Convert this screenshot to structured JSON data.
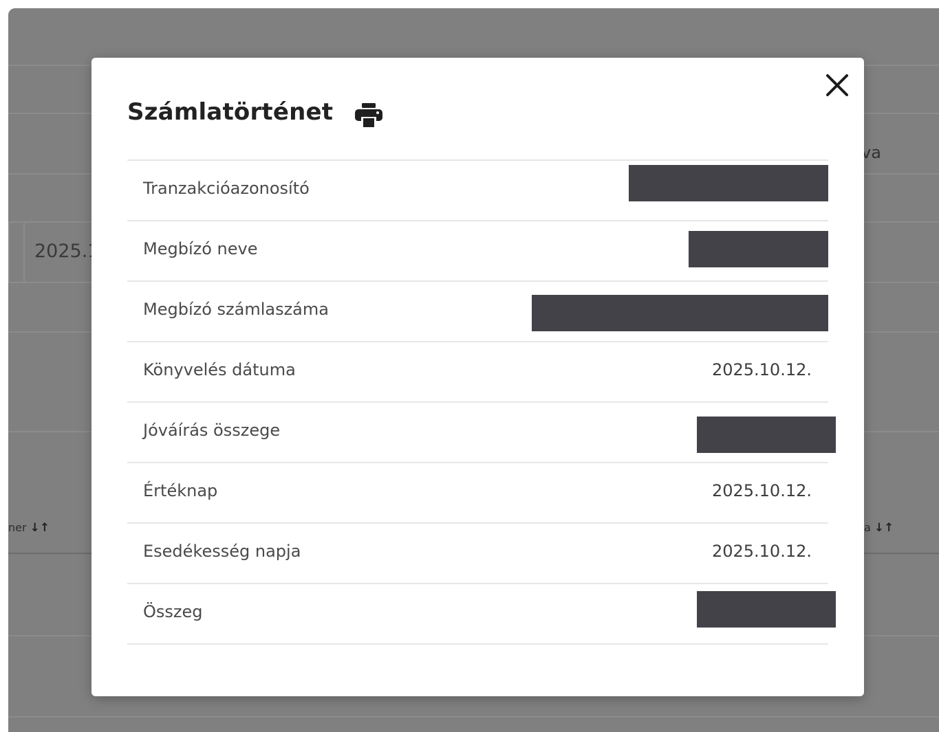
{
  "background": {
    "date_fragment": "2025.1",
    "header_fragment_right": "va",
    "sort_fragment_left": "ner",
    "sort_fragment_right": "a",
    "sort_glyph": "↓↑"
  },
  "modal": {
    "title": "Számlatörténet",
    "print_icon": "print-icon",
    "close_icon": "close-icon",
    "rows": [
      {
        "label": "Tranzakcióazonosító",
        "value": "",
        "redacted": true
      },
      {
        "label": "Megbízó neve",
        "value": "",
        "redacted": true
      },
      {
        "label": "Megbízó számlaszáma",
        "value": "",
        "redacted": true
      },
      {
        "label": "Könyvelés dátuma",
        "value": "2025.10.12.",
        "redacted": false
      },
      {
        "label": "Jóváírás összege",
        "value": "",
        "redacted": true
      },
      {
        "label": "Értéknap",
        "value": "2025.10.12.",
        "redacted": false
      },
      {
        "label": "Esedékesség napja",
        "value": "2025.10.12.",
        "redacted": false
      },
      {
        "label": "Összeg",
        "value": "",
        "redacted": true
      }
    ]
  },
  "colors": {
    "overlay": "#808080",
    "redaction": "#434248",
    "divider": "#e7e7e7"
  }
}
